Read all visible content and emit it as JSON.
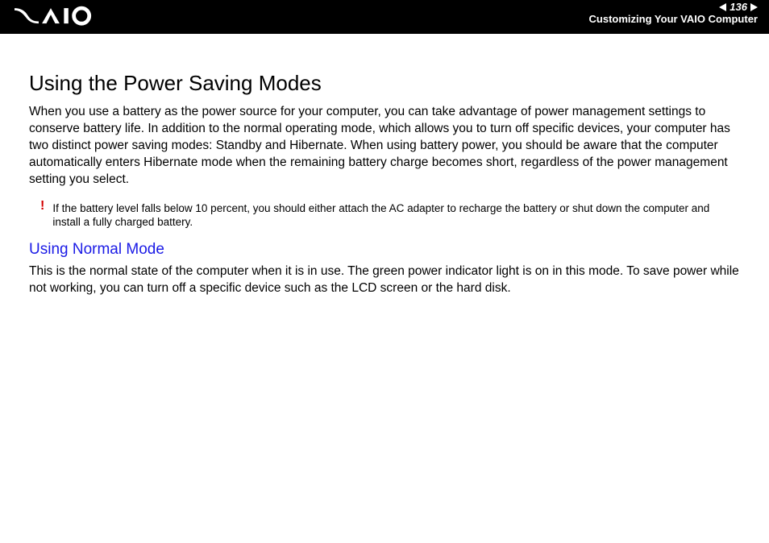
{
  "header": {
    "page_number": "136",
    "section": "Customizing Your VAIO Computer"
  },
  "main": {
    "title": "Using the Power Saving Modes",
    "intro": "When you use a battery as the power source for your computer, you can take advantage of power management settings to conserve battery life. In addition to the normal operating mode, which allows you to turn off specific devices, your computer has two distinct power saving modes: Standby and Hibernate. When using battery power, you should be aware that the computer automatically enters Hibernate mode when the remaining battery charge becomes short, regardless of the power management setting you select.",
    "warning": "If the battery level falls below 10 percent, you should either attach the AC adapter to recharge the battery or shut down the computer and install a fully charged battery.",
    "subheading": "Using Normal Mode",
    "sub_body": "This is the normal state of the computer when it is in use. The green power indicator light is on in this mode. To save power while not working, you can turn off a specific device such as the LCD screen or the hard disk."
  }
}
